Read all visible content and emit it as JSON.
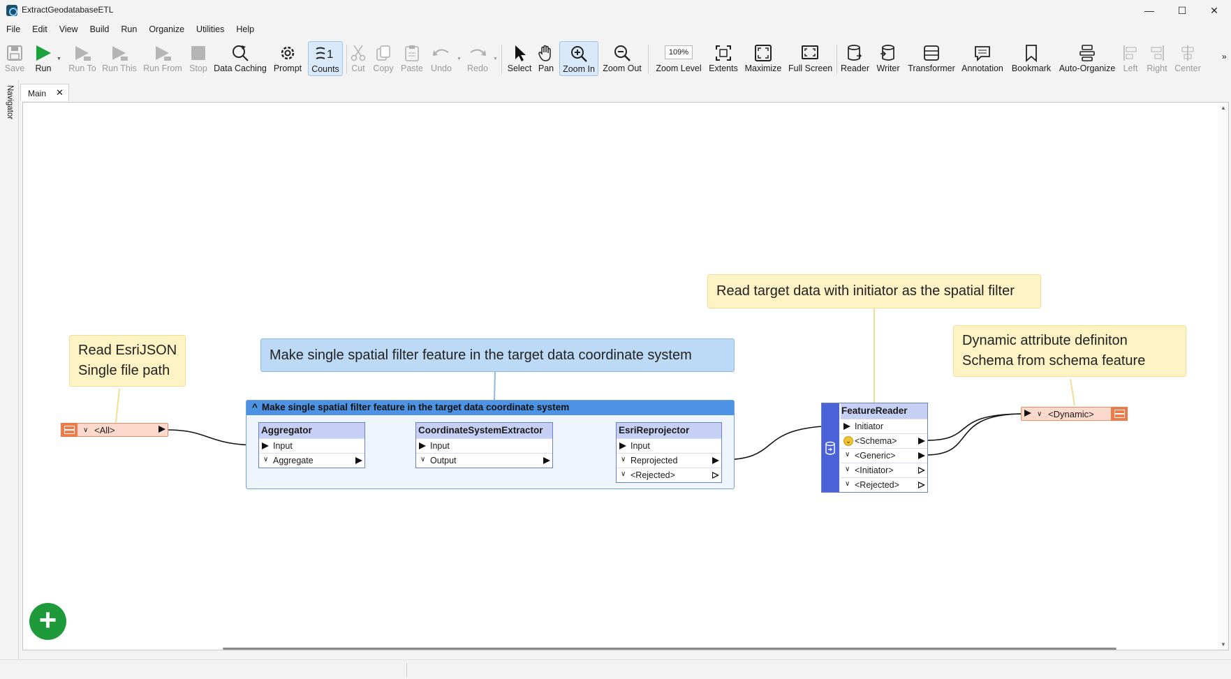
{
  "window": {
    "title": "ExtractGeodatabaseETL",
    "minimize": "—",
    "maximize": "☐",
    "close": "✕"
  },
  "menu": [
    "File",
    "Edit",
    "View",
    "Build",
    "Run",
    "Organize",
    "Utilities",
    "Help"
  ],
  "toolbar": {
    "save": "Save",
    "run": "Run",
    "run_to": "Run To",
    "run_this": "Run This",
    "run_from": "Run From",
    "stop": "Stop",
    "data_caching": "Data Caching",
    "prompt": "Prompt",
    "counts": "Counts",
    "cut": "Cut",
    "copy": "Copy",
    "paste": "Paste",
    "undo": "Undo",
    "redo": "Redo",
    "select": "Select",
    "pan": "Pan",
    "zoom_in": "Zoom In",
    "zoom_out": "Zoom Out",
    "zoom_level_value": "109%",
    "zoom_level": "Zoom Level",
    "extents": "Extents",
    "maximize": "Maximize",
    "full_screen": "Full Screen",
    "reader": "Reader",
    "writer": "Writer",
    "transformer": "Transformer",
    "annotation": "Annotation",
    "bookmark": "Bookmark",
    "auto_organize": "Auto-Organize",
    "left": "Left",
    "right": "Right",
    "center": "Center",
    "overflow": "»"
  },
  "navigator": {
    "label": "Navigator"
  },
  "tabs": [
    {
      "label": "Main",
      "close": "✕"
    }
  ],
  "canvas": {
    "annotations": {
      "read_esrijson_line1": "Read EsriJSON",
      "read_esrijson_line2": "Single file path",
      "make_filter": "Make single spatial filter feature in the target data coordinate system",
      "read_target": "Read target data with initiator as the spatial filter",
      "dynamic_line1": "Dynamic attribute definiton",
      "dynamic_line2": "Schema from schema feature"
    },
    "bookmark": {
      "collapse": "^",
      "title": "Make single spatial filter feature in the target data coordinate system"
    },
    "source_feature_type": {
      "chev": "∨",
      "label": "<All>"
    },
    "dest_feature_type": {
      "chev": "∨",
      "label": "<Dynamic>"
    },
    "aggregator": {
      "name": "Aggregator",
      "input": "Input",
      "output": "Aggregate"
    },
    "cs_extractor": {
      "name": "CoordinateSystemExtractor",
      "input": "Input",
      "output": "Output"
    },
    "reprojector": {
      "name": "EsriReprojector",
      "input": "Input",
      "output": "Reprojected",
      "rejected": "<Rejected>"
    },
    "feature_reader": {
      "name": "FeatureReader",
      "input": "Initiator",
      "outputs": [
        "<Schema>",
        "<Generic>",
        "<Initiator>",
        "<Rejected>"
      ]
    },
    "chevron": "∨",
    "add_button": "+"
  }
}
